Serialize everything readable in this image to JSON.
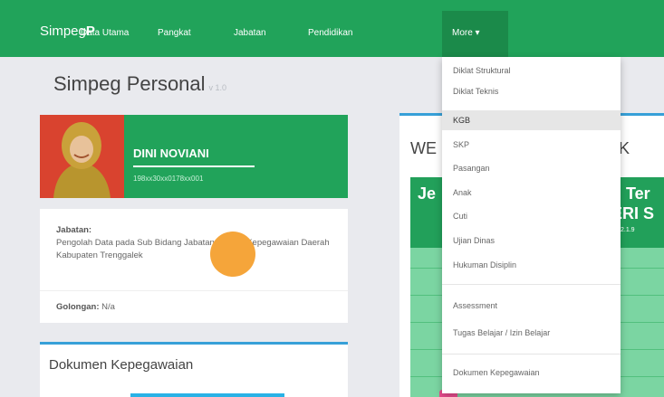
{
  "navbar": {
    "brand_pre": "Simpeg",
    "brand_bold": "P",
    "links": [
      "Data Utama",
      "Pangkat",
      "Jabatan",
      "Pendidikan"
    ],
    "more_label": "More ▾"
  },
  "page": {
    "title": "Simpeg Personal",
    "version": "v 1.0"
  },
  "profile": {
    "name": "DINI NOVIANI",
    "nip": "198xx30xx0178xx001"
  },
  "info": {
    "jabatan_label": "Jabatan:",
    "jabatan_value": "Pengolah Data pada Sub Bidang Jabatan, Badan Kepegawaian Daerah Kabupaten Trenggalek",
    "golongan_label": "Golongan:",
    "golongan_value": "N/a"
  },
  "dokumen": {
    "title": "Dokumen Kepegawaian"
  },
  "welcome": {
    "title_left": "WE",
    "title_right": "K",
    "banner_left": "Je",
    "banner_right1": "n Ter",
    "banner_right2": "ERI S",
    "banner_small": "2.1.9"
  },
  "dropdown": {
    "items": [
      "Diklat Struktural",
      "Diklat Teknis",
      "KGB",
      "SKP",
      "Pasangan",
      "Anak",
      "Cuti",
      "Ujian Dinas",
      "Hukuman Disiplin",
      "Assessment",
      "Tugas Belajar / Izin Belajar",
      "Dokumen Kepegawaian"
    ],
    "active_item": "KGB"
  },
  "colors": {
    "primary_green": "#21a35a",
    "accent_blue": "#37a0d8",
    "photo_bg": "#d9432f"
  }
}
